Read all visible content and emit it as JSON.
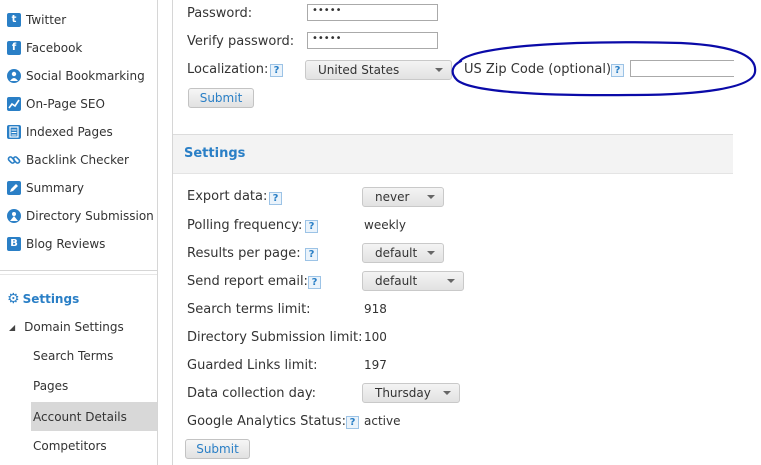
{
  "sidebar": {
    "items": [
      {
        "label": "Twitter",
        "icon": "twitter-icon",
        "glyph": "t"
      },
      {
        "label": "Facebook",
        "icon": "facebook-icon",
        "glyph": "f"
      },
      {
        "label": "Social Bookmarking",
        "icon": "person-icon",
        "glyph": "👤"
      },
      {
        "label": "On-Page SEO",
        "icon": "chart-icon",
        "glyph": "↗"
      },
      {
        "label": "Indexed Pages",
        "icon": "pages-icon",
        "glyph": "▤"
      },
      {
        "label": "Backlink Checker",
        "icon": "link-icon",
        "glyph": "∞"
      },
      {
        "label": "Summary",
        "icon": "summary-icon",
        "glyph": "✎"
      },
      {
        "label": "Directory Submission",
        "icon": "directory-icon",
        "glyph": "⚘"
      },
      {
        "label": "Blog Reviews",
        "icon": "blog-icon",
        "glyph": "B"
      }
    ],
    "settings_label": "Settings",
    "domain_settings_label": "Domain Settings",
    "sub_items": [
      {
        "label": "Search Terms"
      },
      {
        "label": "Pages"
      },
      {
        "label": "Account Details"
      },
      {
        "label": "Competitors"
      }
    ],
    "active_sub_item": "Account Details"
  },
  "account": {
    "password_label": "Password:",
    "password_value": "•••••",
    "verify_label": "Verify password:",
    "verify_value": "•••••",
    "localization_label": "Localization:",
    "localization_value": "United States",
    "zip_label": "US Zip Code (optional):",
    "zip_value": "",
    "submit_label": "Submit",
    "help_glyph": "?"
  },
  "settings": {
    "title": "Settings",
    "export_label": "Export data:",
    "export_value": "never",
    "polling_label": "Polling frequency:",
    "polling_value": "weekly",
    "results_label": "Results per page:",
    "results_value": "default",
    "report_label": "Send report email:",
    "report_value": "default",
    "search_terms_label": "Search terms limit:",
    "search_terms_value": "918",
    "directory_label": "Directory Submission limit:",
    "directory_value": "100",
    "guarded_label": "Guarded Links limit:",
    "guarded_value": "197",
    "collection_label": "Data collection day:",
    "collection_value": "Thursday",
    "ga_label": "Google Analytics Status:",
    "ga_value": "active",
    "submit_label": "Submit"
  },
  "colors": {
    "accent": "#2a7fc6",
    "annotation": "#0a0aa8"
  }
}
